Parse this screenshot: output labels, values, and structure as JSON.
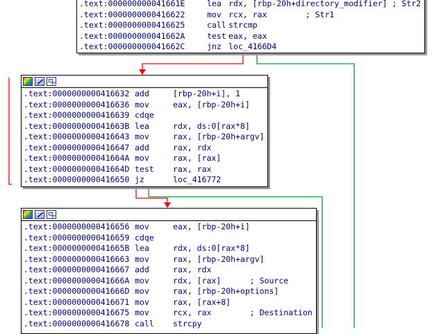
{
  "colors": {
    "red_edge": "#ff0000",
    "green_edge": "#00a040",
    "text": "#000080",
    "shadow": "#9a9a9a"
  },
  "icons": [
    "color-palette-icon",
    "brush-icon",
    "graph-overview-icon"
  ],
  "blocks": [
    {
      "name": "block-top",
      "lines": [
        {
          "addr": ".text:000000000041661E",
          "mn": "lea",
          "ops": "rdx, [rbp-20h+directory_modifier] ; Str2"
        },
        {
          "addr": ".text:0000000000416622",
          "mn": "mov",
          "ops": "rcx, rax        ; Str1"
        },
        {
          "addr": ".text:0000000000416625",
          "mn": "call",
          "ops": "strcmp"
        },
        {
          "addr": ".text:000000000041662A",
          "mn": "test",
          "ops": "eax, eax"
        },
        {
          "addr": ".text:000000000041662C",
          "mn": "jnz",
          "ops": "loc_4166D4"
        }
      ]
    },
    {
      "name": "block-middle",
      "lines": [
        {
          "addr": ".text:0000000000416632",
          "mn": "add",
          "ops": "[rbp-20h+i], 1"
        },
        {
          "addr": ".text:0000000000416636",
          "mn": "mov",
          "ops": "eax, [rbp-20h+i]"
        },
        {
          "addr": ".text:0000000000416639",
          "mn": "cdqe",
          "ops": ""
        },
        {
          "addr": ".text:000000000041663B",
          "mn": "lea",
          "ops": "rdx, ds:0[rax*8]"
        },
        {
          "addr": ".text:0000000000416643",
          "mn": "mov",
          "ops": "rax, [rbp-20h+argv]"
        },
        {
          "addr": ".text:0000000000416647",
          "mn": "add",
          "ops": "rax, rdx"
        },
        {
          "addr": ".text:000000000041664A",
          "mn": "mov",
          "ops": "rax, [rax]"
        },
        {
          "addr": ".text:000000000041664D",
          "mn": "test",
          "ops": "rax, rax"
        },
        {
          "addr": ".text:0000000000416650",
          "mn": "jz",
          "ops": "loc_416772"
        }
      ]
    },
    {
      "name": "block-bottom",
      "lines": [
        {
          "addr": ".text:0000000000416656",
          "mn": "mov",
          "ops": "eax, [rbp-20h+i]"
        },
        {
          "addr": ".text:0000000000416659",
          "mn": "cdqe",
          "ops": ""
        },
        {
          "addr": ".text:000000000041665B",
          "mn": "lea",
          "ops": "rdx, ds:0[rax*8]"
        },
        {
          "addr": ".text:0000000000416663",
          "mn": "mov",
          "ops": "rax, [rbp-20h+argv]"
        },
        {
          "addr": ".text:0000000000416667",
          "mn": "add",
          "ops": "rax, rdx"
        },
        {
          "addr": ".text:000000000041666A",
          "mn": "mov",
          "ops": "rdx, [rax]      ; Source"
        },
        {
          "addr": ".text:000000000041666D",
          "mn": "mov",
          "ops": "rax, [rbp-20h+options]"
        },
        {
          "addr": ".text:0000000000416671",
          "mn": "mov",
          "ops": "rax, [rax+8]"
        },
        {
          "addr": ".text:0000000000416675",
          "mn": "mov",
          "ops": "rcx, rax        ; Destination"
        },
        {
          "addr": ".text:0000000000416678",
          "mn": "call",
          "ops": "strcpy"
        }
      ]
    }
  ]
}
